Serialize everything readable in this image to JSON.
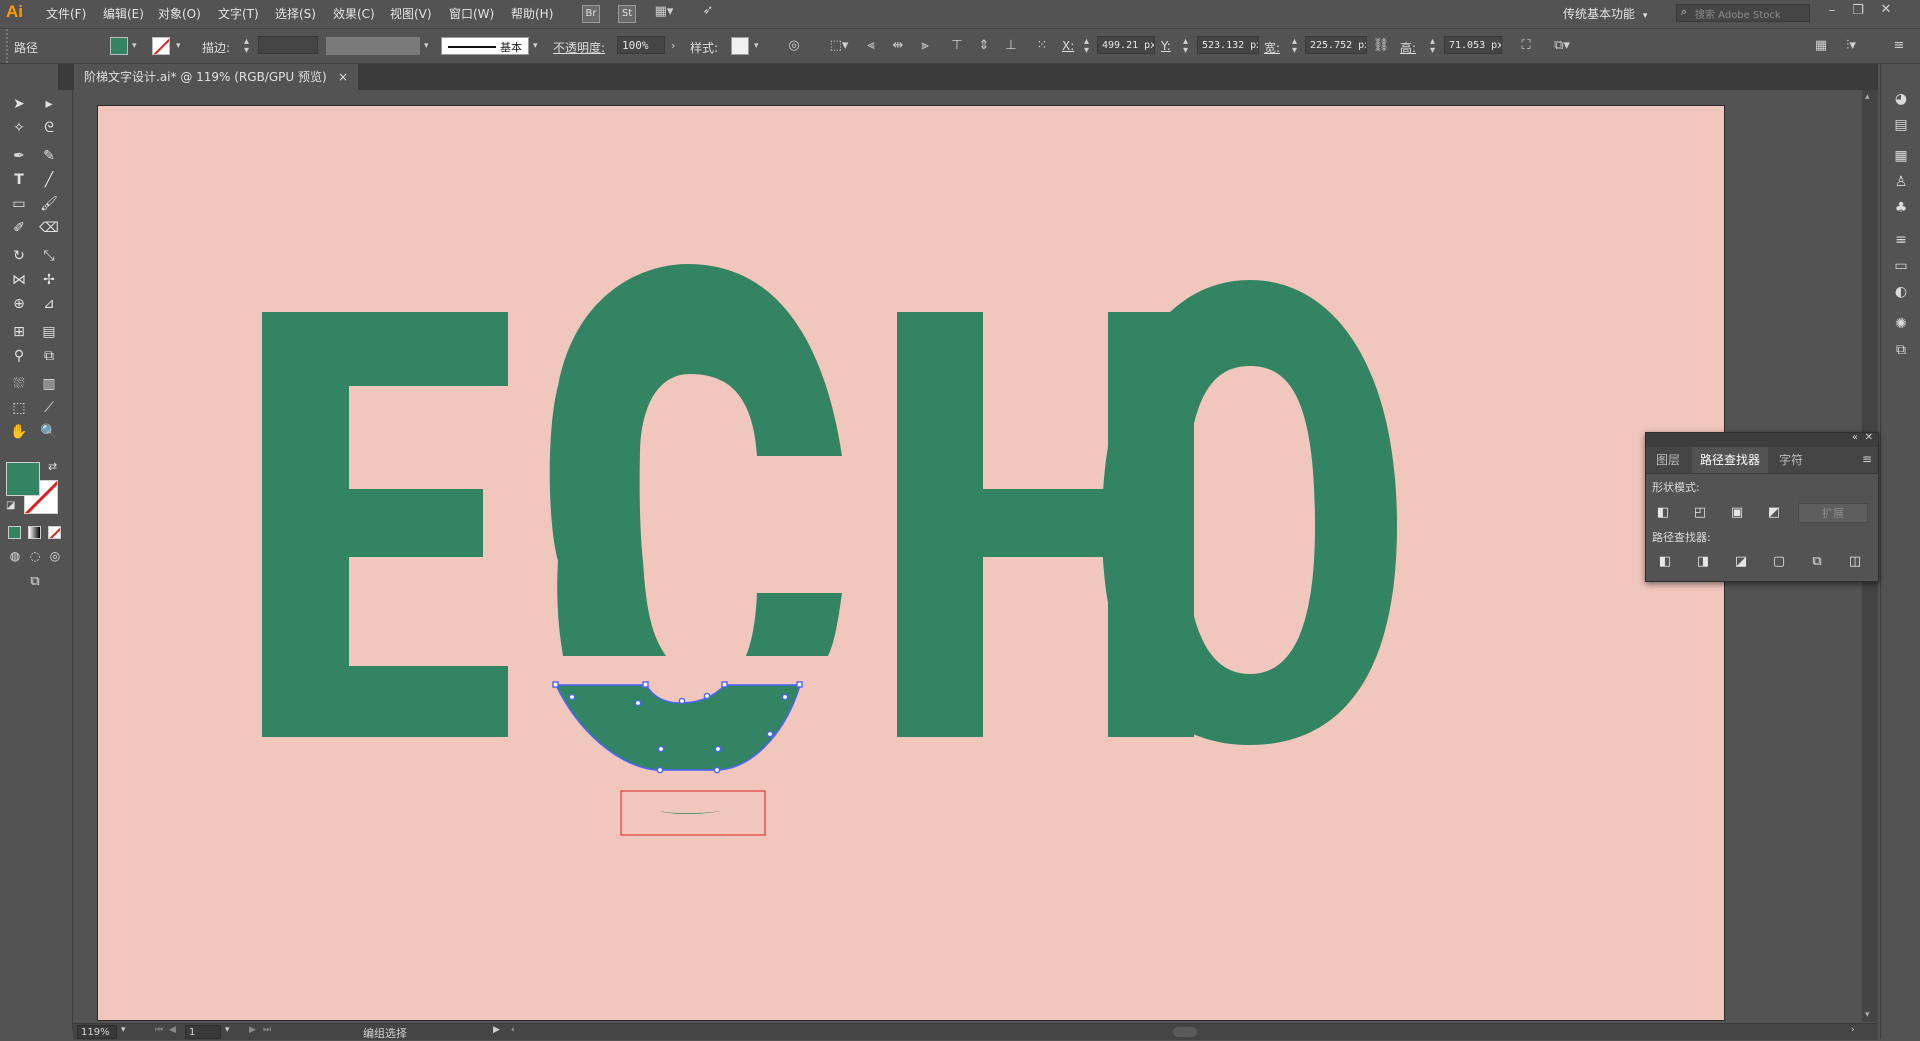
{
  "app": {
    "logo": "Ai"
  },
  "menu": [
    "文件(F)",
    "编辑(E)",
    "对象(O)",
    "文字(T)",
    "选择(S)",
    "效果(C)",
    "视图(V)",
    "窗口(W)",
    "帮助(H)"
  ],
  "app_bar": {
    "bridge_label": "Br",
    "stock_label": "St",
    "workspace": "传统基本功能",
    "search_placeholder": "搜索 Adobe Stock"
  },
  "control_bar": {
    "object_type": "路径",
    "fill_color": "#338462",
    "stroke_label": "描边:",
    "stroke_profile": "基本",
    "opacity_label": "不透明度:",
    "opacity_value": "100%",
    "style_label": "样式:",
    "x_label": "X:",
    "x_value": "499.21 px",
    "y_label": "Y:",
    "y_value": "523.132 px",
    "w_label": "宽:",
    "w_value": "225.752 px",
    "h_label": "高:",
    "h_value": "71.053 px"
  },
  "document_tab": {
    "title": "阶梯文字设计.ai* @ 119% (RGB/GPU 预览)",
    "close": "×"
  },
  "artwork": {
    "text": "ECHO",
    "text_color": "#338462",
    "artboard_color": "#f1c6bc",
    "selection_color": "#4a62ff",
    "highlight_box_color": "#e03a3a"
  },
  "pathfinder_panel": {
    "tabs": [
      "图层",
      "路径查找器",
      "字符"
    ],
    "active_tab": "路径查找器",
    "shape_modes_label": "形状模式:",
    "pathfinders_label": "路径查找器:",
    "expand_label": "扩展"
  },
  "status_bar": {
    "zoom": "119%",
    "artboard_number": "1",
    "status_text": "编组选择"
  }
}
